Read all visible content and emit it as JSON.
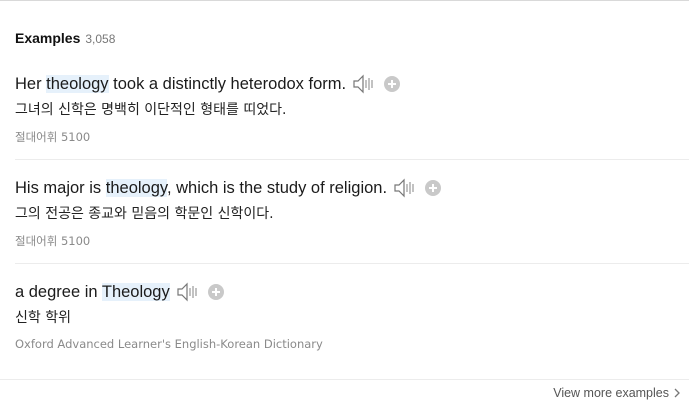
{
  "section": {
    "title": "Examples",
    "count": "3,058"
  },
  "examples": [
    {
      "before": "Her ",
      "highlight": "theology",
      "after": " took a distinctly heterodox form.",
      "translation": "그녀의 신학은 명백히 이단적인 형태를 띠었다.",
      "source": "절대어휘 5100"
    },
    {
      "before": "His major is ",
      "highlight": "theology",
      "after": ", which is the study of religion.",
      "translation": "그의 전공은 종교와 믿음의 학문인 신학이다.",
      "source": "절대어휘 5100"
    },
    {
      "before": "a degree in ",
      "highlight": "Theology",
      "after": "",
      "translation": "신학 학위",
      "source": "Oxford Advanced Learner's English-Korean Dictionary"
    }
  ],
  "footer": {
    "more_label": "View more examples"
  },
  "icons": {
    "audio": "speaker-icon",
    "add": "plus-circle-icon",
    "more": "chevron-right-icon"
  },
  "colors": {
    "highlight_bg": "#e6f1fb",
    "add_button": "#c9c9c9"
  }
}
